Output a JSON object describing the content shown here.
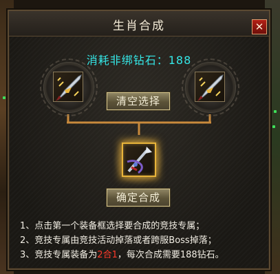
{
  "window": {
    "title": "生肖合成",
    "close_label": "✕"
  },
  "cost": {
    "label": "消耗非绑钻石：",
    "amount": "188"
  },
  "buttons": {
    "clear": "清空选择",
    "confirm": "确定合成"
  },
  "slots": {
    "left_icon": "sword-icon",
    "right_icon": "sword-icon",
    "result_icon": "crossbow-icon"
  },
  "instructions": [
    {
      "index": "1、",
      "text": "点击第一个装备框选择要合成的竞技专属；"
    },
    {
      "index": "2、",
      "text": "竞技专属由竞技活动掉落或者跨服Boss掉落；"
    },
    {
      "index": "3、",
      "pre": "竞技专属装备为",
      "highlight": "2合1",
      "post": "，每次合成需要188钻石。"
    }
  ],
  "colors": {
    "cost_text": "#35e8e8",
    "highlight": "#ff3a2a",
    "result_border": "#e8b43a",
    "wire": "#c98a3c"
  }
}
